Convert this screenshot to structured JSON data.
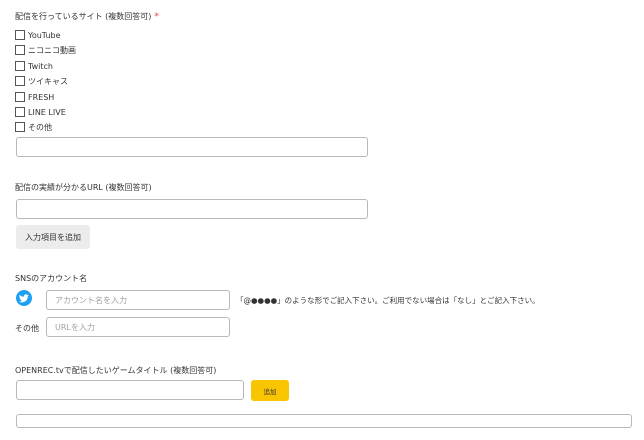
{
  "form": {
    "sites": {
      "label": "配信を行っているサイト (複数回答可)",
      "required_mark": "*",
      "options": [
        "YouTube",
        "ニコニコ動画",
        "Twitch",
        "ツイキャス",
        "FRESH",
        "LINE LIVE",
        "その他"
      ],
      "other_value": ""
    },
    "url": {
      "label": "配信の実績が分かるURL (複数回答可)",
      "value": "",
      "add_button": "入力項目を追加"
    },
    "sns": {
      "label": "SNSのアカウント名",
      "twitter_placeholder": "アカウント名を入力",
      "twitter_note": "「@●●●●」のような形でご記入下さい。ご利用でない場合は「なし」とご記入下さい。",
      "other_label": "その他",
      "other_placeholder": "URLを入力"
    },
    "games": {
      "label": "OPENREC.tvで配信したいゲームタイトル (複数回答可)",
      "value": "",
      "add_button": "追加",
      "list_value": ""
    }
  },
  "icons": {
    "twitter": "twitter-bird-icon"
  },
  "colors": {
    "required": "#e53935",
    "twitter": "#1da1f2",
    "add_button": "#f9c400"
  }
}
